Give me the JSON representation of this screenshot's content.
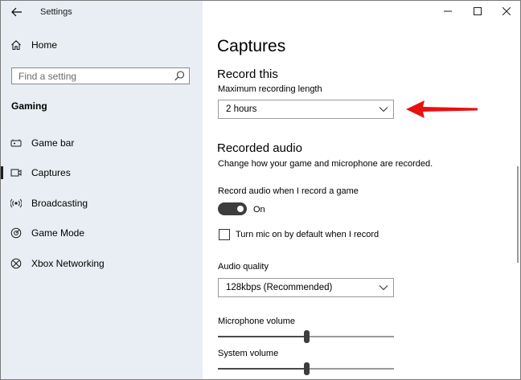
{
  "window": {
    "title": "Settings",
    "icons": {
      "back": "arrow-left-icon",
      "minimize": "minimize-icon",
      "maximize": "maximize-icon",
      "close": "close-icon"
    }
  },
  "sidebar": {
    "home_label": "Home",
    "search_placeholder": "Find a setting",
    "section_heading": "Gaming",
    "items": [
      {
        "label": "Game bar",
        "icon": "game-bar-icon",
        "active": false
      },
      {
        "label": "Captures",
        "icon": "captures-icon",
        "active": true
      },
      {
        "label": "Broadcasting",
        "icon": "broadcasting-icon",
        "active": false
      },
      {
        "label": "Game Mode",
        "icon": "game-mode-icon",
        "active": false
      },
      {
        "label": "Xbox Networking",
        "icon": "xbox-icon",
        "active": false
      }
    ]
  },
  "main": {
    "page_title": "Captures",
    "record_this": {
      "heading": "Record this",
      "max_length_label": "Maximum recording length",
      "max_length_value": "2 hours"
    },
    "recorded_audio": {
      "heading": "Recorded audio",
      "description": "Change how your game and microphone are recorded.",
      "record_audio_label": "Record audio when I record a game",
      "record_audio_state": "On",
      "mic_default_label": "Turn mic on by default when I record",
      "mic_default_checked": false,
      "audio_quality_label": "Audio quality",
      "audio_quality_value": "128kbps (Recommended)",
      "microphone_volume_label": "Microphone volume",
      "microphone_volume_level": 0.5,
      "system_volume_label": "System volume",
      "system_volume_level": 0.5
    }
  },
  "colors": {
    "sidebar_bg": "#e8eef3",
    "annotation_arrow": "#e81010",
    "toggle_on": "#3d3d3d"
  }
}
